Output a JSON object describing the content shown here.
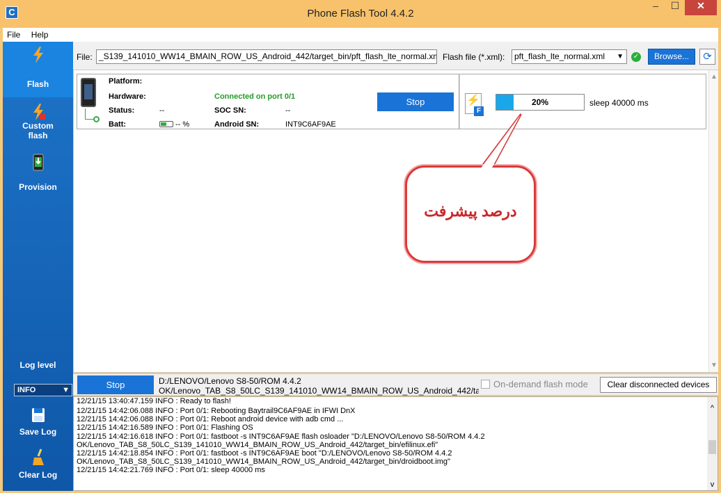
{
  "window": {
    "title": "Phone Flash Tool 4.4.2",
    "minimize": "–",
    "maximize": "☐",
    "close": "✕",
    "app_icon": "C"
  },
  "menu": {
    "items": [
      "File",
      "Help"
    ]
  },
  "sidebar": {
    "flash": "Flash",
    "custom_flash_1": "Custom",
    "custom_flash_2": "flash",
    "provision": "Provision",
    "log_level_label": "Log level",
    "log_level_value": "INFO",
    "save_log": "Save Log",
    "clear_log": "Clear Log"
  },
  "filebar": {
    "file_label": "File:",
    "file_value": "_S139_141010_WW14_BMAIN_ROW_US_Android_442/target_bin/pft_flash_lte_normal.xml",
    "flash_file_label": "Flash file (*.xml):",
    "flash_file_value": "pft_flash_lte_normal.xml",
    "browse": "Browse...",
    "check_icon": "check-circle-icon",
    "refresh_icon": "refresh-icon"
  },
  "device": {
    "platform_label": "Platform:",
    "hardware_label": "Hardware:",
    "status_label": "Status:",
    "status_value": "--",
    "batt_label": "Batt:",
    "batt_value": "-- %",
    "connection": "Connected on port 0/1",
    "soc_label": "SOC SN:",
    "soc_value": "--",
    "android_label": "Android SN:",
    "android_value": "INT9C6AF9AE",
    "stop": "Stop"
  },
  "progress": {
    "percent": 20,
    "percent_text": "20%",
    "status": "sleep 40000 ms",
    "flash_icon": "⚡",
    "flash_badge": "F"
  },
  "callout": {
    "text": "درصد پیشرفت"
  },
  "bottom": {
    "stop": "Stop",
    "path_line1": "D:/LENOVO/Lenovo S8-50/ROM 4.4.2",
    "path_line2": "OK/Lenovo_TAB_S8_50LC_S139_141010_WW14_BMAIN_ROW_US_Android_442/targ",
    "ondemand": "On-demand flash mode",
    "clear_disconnected": "Clear disconnected devices"
  },
  "log": {
    "lines": [
      "12/21/15 13:40:47.159  INFO   : Ready to flash!",
      "12/21/15 14:42:06.088  INFO   : Port 0/1: Rebooting Baytrail9C6AF9AE in IFWI DnX",
      "12/21/15 14:42:06.088  INFO   : Port 0/1: Reboot android device with adb cmd ...",
      "12/21/15 14:42:16.589  INFO   : Port 0/1: Flashing OS",
      "12/21/15 14:42:16.618  INFO   : Port 0/1: fastboot -s INT9C6AF9AE  flash osloader \"D:/LENOVO/Lenovo S8-50/ROM 4.4.2",
      "OK/Lenovo_TAB_S8_50LC_S139_141010_WW14_BMAIN_ROW_US_Android_442/target_bin/efilinux.efi\"",
      "12/21/15 14:42:18.854  INFO   : Port 0/1: fastboot -s INT9C6AF9AE  boot \"D:/LENOVO/Lenovo S8-50/ROM 4.4.2",
      "OK/Lenovo_TAB_S8_50LC_S139_141010_WW14_BMAIN_ROW_US_Android_442/target_bin/droidboot.img\"",
      "12/21/15 14:42:21.769  INFO   : Port 0/1: sleep 40000 ms"
    ]
  }
}
